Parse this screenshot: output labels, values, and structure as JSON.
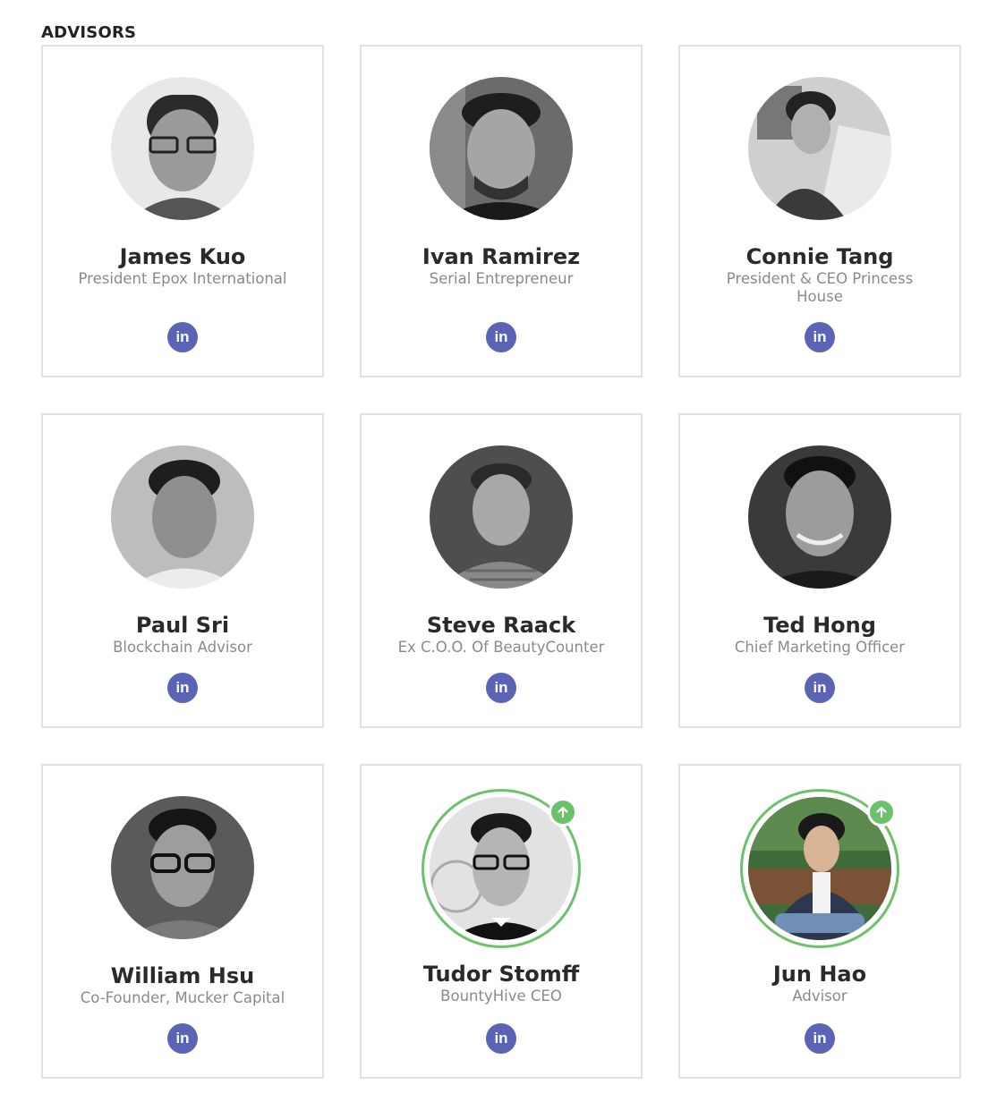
{
  "section": {
    "title": "ADVISORS"
  },
  "linkedin_icon_text": "in",
  "colors": {
    "linkedin": "#5b63b5",
    "featured_ring": "#6cc26a",
    "card_border": "#e1e1e1"
  },
  "advisors": [
    {
      "name": "James Kuo",
      "role": "President Epox International",
      "featured": false
    },
    {
      "name": "Ivan Ramirez",
      "role": "Serial Entrepreneur",
      "featured": false
    },
    {
      "name": "Connie Tang",
      "role": "President & CEO Princess House",
      "featured": false
    },
    {
      "name": "Paul Sri",
      "role": "Blockchain Advisor",
      "featured": false
    },
    {
      "name": "Steve Raack",
      "role": "Ex C.O.O. Of BeautyCounter",
      "featured": false
    },
    {
      "name": "Ted Hong",
      "role": "Chief Marketing Officer",
      "featured": false
    },
    {
      "name": "William Hsu",
      "role": "Co-Founder, Mucker Capital",
      "featured": false
    },
    {
      "name": "Tudor Stomff",
      "role": "BountyHive CEO",
      "featured": true
    },
    {
      "name": "Jun Hao",
      "role": "Advisor",
      "featured": true
    }
  ]
}
